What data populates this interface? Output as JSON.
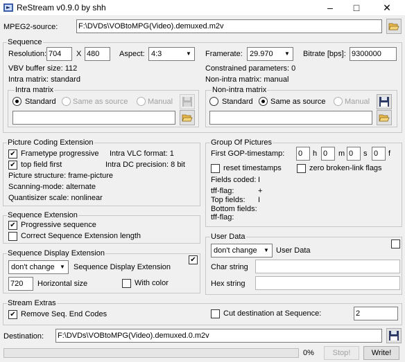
{
  "window": {
    "title": "ReStream v0.9.0 by shh"
  },
  "source": {
    "label": "MPEG2-source:",
    "path": "F:\\DVDs\\VOBtoMPG(Video).demuxed.m2v"
  },
  "sequence": {
    "title": "Sequence",
    "resolution_label": "Resolution:",
    "width": "704",
    "x_label": "X",
    "height": "480",
    "aspect_label": "Aspect:",
    "aspect_value": "4:3",
    "framerate_label": "Framerate:",
    "framerate_value": "29.970",
    "bitrate_label": "Bitrate [bps]:",
    "bitrate_value": "9300000",
    "vbv": "VBV buffer size: 112",
    "constrained": "Constrained parameters: 0",
    "intra_matrix_info": "Intra matrix: standard",
    "non_intra_matrix_info": "Non-intra matrix: manual",
    "intra_matrix": {
      "title": "Intra matrix",
      "options": [
        "Standard",
        "Same as source",
        "Manual"
      ],
      "selected": "Standard",
      "value": ""
    },
    "non_intra_matrix": {
      "title": "Non-intra matrix",
      "options": [
        "Standard",
        "Same as source",
        "Manual"
      ],
      "selected": "Same as source",
      "value": ""
    }
  },
  "picture_coding": {
    "title": "Picture Coding Extension",
    "frametype_progressive": {
      "label": "Frametype progressive",
      "checked": true
    },
    "intra_vlc": "Intra VLC format: 1",
    "top_field_first": {
      "label": "top field first",
      "checked": true
    },
    "intra_dc": "Intra DC precision: 8 bit",
    "structure": "Picture structure: frame-picture",
    "scanning": "Scanning-mode: alternate",
    "quantiser": "Quantisizer scale: nonlinear"
  },
  "gop": {
    "title": "Group Of Pictures",
    "timestamp_label": "First GOP-timestamp:",
    "h": "0",
    "h_label": "h",
    "m": "0",
    "m_label": "m",
    "s": "0",
    "s_label": "s",
    "f": "0",
    "f_label": "f",
    "reset_timestamps": {
      "label": "reset timestamps",
      "checked": false
    },
    "zero_broken": {
      "label": "zero broken-link flags",
      "checked": false
    },
    "fields_coded_label": "Fields coded:",
    "fields_coded_value": "I",
    "tff_flag_label": "tff-flag:",
    "tff_flag_value": "+",
    "top_fields_label": "Top fields:",
    "top_fields_value": "I",
    "bottom_fields_label": "Bottom fields:",
    "tff_flag2_label": "tff-flag:"
  },
  "sequence_ext": {
    "title": "Sequence Extension",
    "progressive": {
      "label": "Progressive sequence",
      "checked": true
    },
    "correct_length": {
      "label": "Correct Sequence Extension length",
      "checked": false
    }
  },
  "user_data": {
    "title": "User Data",
    "mode": "don't change",
    "label": "User Data",
    "char_label": "Char string",
    "hex_label": "Hex string",
    "char_value": "",
    "hex_value": ""
  },
  "seq_display": {
    "title": "Sequence Display Extension",
    "mode": "don't change",
    "label": "Sequence Display Extension",
    "hsize": "720",
    "hsize_label": "Horizontal size",
    "with_color": {
      "label": "With color",
      "checked": false
    },
    "enabled": true
  },
  "stream_extras": {
    "title": "Stream Extras",
    "remove_end_codes": {
      "label": "Remove Seq. End Codes",
      "checked": true
    },
    "cut_destination": {
      "label": "Cut destination at Sequence:",
      "checked": false
    },
    "cut_value": "2"
  },
  "destination": {
    "label": "Destination:",
    "path": "F:\\DVDs\\VOBtoMPG(Video).demuxed.0.m2v"
  },
  "status": {
    "progress_percent": 0,
    "progress_text": "0%",
    "stop_label": "Stop!",
    "write_label": "Write!"
  },
  "colors": {
    "progress_fill": "#06b025",
    "folder": "#e8b84a",
    "disk": "#2d3a66"
  },
  "icons": [
    "app-icon",
    "minimize-icon",
    "maximize-icon",
    "close-icon",
    "folder-open-icon",
    "save-disk-icon"
  ]
}
